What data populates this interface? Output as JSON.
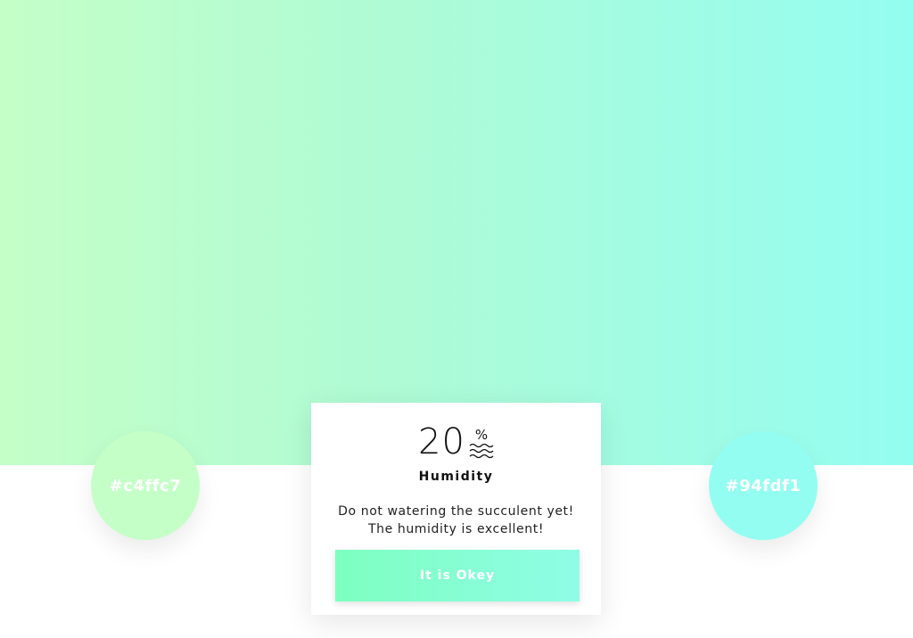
{
  "palette": {
    "start": {
      "hex_label": "#c4ffc7",
      "color": "#c4ffc7"
    },
    "end": {
      "hex_label": "#94fdf1",
      "color": "#94fdf1"
    }
  },
  "card": {
    "value": "20",
    "unit": "%",
    "icon": "water-waves-icon",
    "label": "Humidity",
    "message_line1": "Do not watering the succulent yet!",
    "message_line2": "The humidity is excellent!",
    "button_label": "It is Okey"
  }
}
